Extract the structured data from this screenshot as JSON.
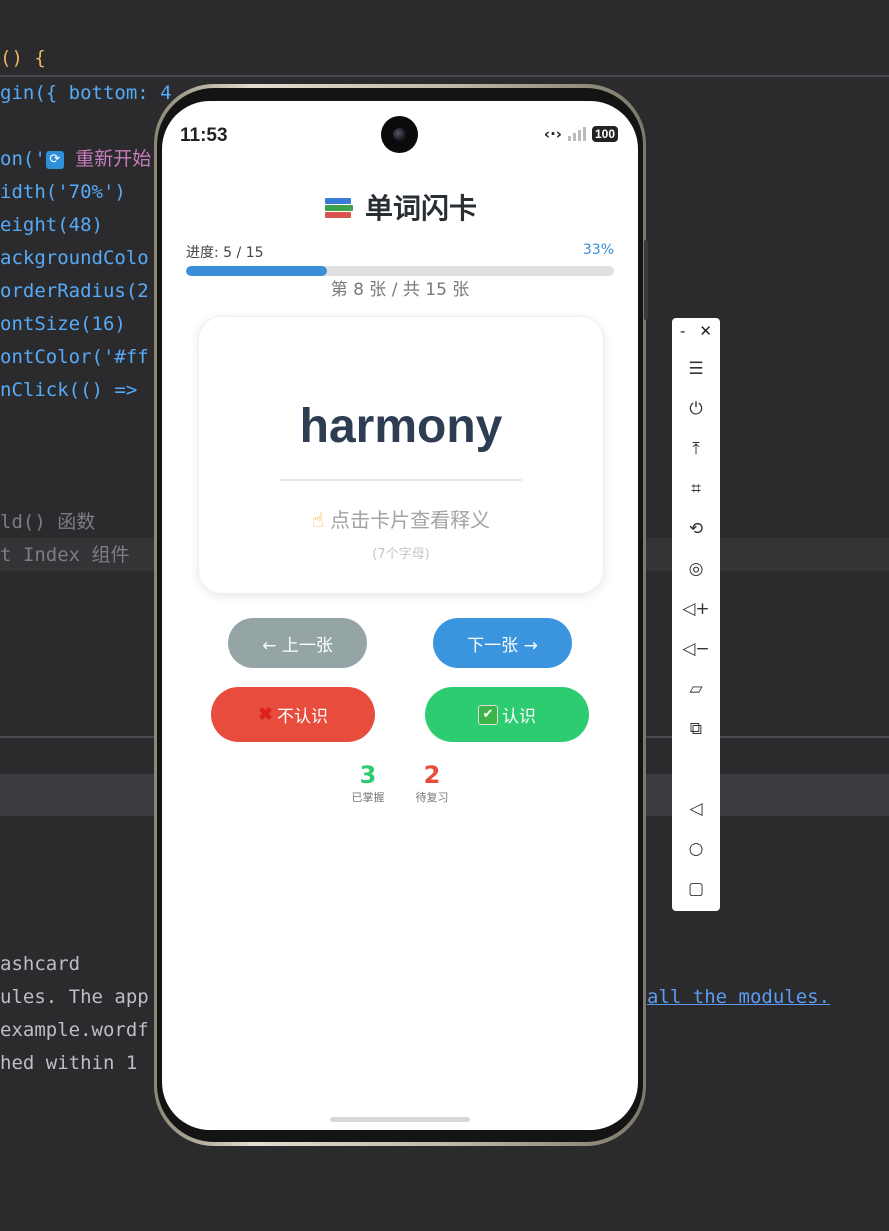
{
  "ide": {
    "code_lines": [
      {
        "text": "() {"
      },
      {
        "text": "gin({ bottom: 4"
      },
      {
        "text": "on('"
      },
      {
        "text": "idth('70%')"
      },
      {
        "text": "eight(48)"
      },
      {
        "text": "ackgroundColo"
      },
      {
        "text": "orderRadius(2"
      },
      {
        "text": "ontSize(16)"
      },
      {
        "text": "ontColor('#ff"
      },
      {
        "text": "nClick(() => "
      },
      {
        "text": "ld() 函数"
      },
      {
        "text": "t Index 组件"
      }
    ],
    "restart_text": "重新开始",
    "console_lines": [
      "ashcard",
      "ules. The app",
      "example.wordf",
      "hed within 1"
    ],
    "console_link": "all the modules."
  },
  "phone": {
    "status": {
      "time": "11:53",
      "battery": "100"
    },
    "app": {
      "title": "单词闪卡",
      "progress_label": "进度: 5 / 15",
      "progress_percent": "33%",
      "progress_value": 0.33,
      "card_count": "第 8 张 / 共 15 张",
      "card": {
        "word": "harmony",
        "hint": "点击卡片查看释义",
        "letters": "(7个字母)"
      },
      "buttons": {
        "prev": "← 上一张",
        "next": "下一张 →",
        "unknown": "不认识",
        "known": "认识"
      },
      "stats": {
        "mastered_count": "3",
        "mastered_label": "已掌握",
        "review_count": "2",
        "review_label": "待复习"
      }
    }
  },
  "toolbar": {
    "items": [
      "menu-icon",
      "power-icon",
      "pin-top-icon",
      "crop-icon",
      "rotate-icon",
      "screenshot-icon",
      "volume-up-icon",
      "volume-down-icon",
      "shake-icon",
      "multi-device-icon",
      "back-icon",
      "home-icon",
      "recents-icon"
    ]
  },
  "colors": {
    "accent": "#3a95de",
    "unknown": "#e74c3c",
    "known": "#2ecc71",
    "prev": "#95a5a6"
  }
}
